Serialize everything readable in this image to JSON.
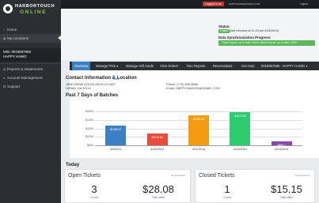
{
  "brand": {
    "name_top": "HARBORTOUCH",
    "name_bottom": "ONLINE"
  },
  "topbar": {
    "logged_in": "Logged in as",
    "user_email": "HAPPYHAWK@GMAIL.COM",
    "logout": "Logout"
  },
  "sidebar": {
    "home": "Home",
    "my_locations": "My Locations",
    "mid_line1": "MID: 0018687658",
    "mid_line2": "HAPPY HAWG",
    "reports": "Reports & Statements",
    "account": "Account Management",
    "support": "Support"
  },
  "status": {
    "label": "Status:",
    "online": "Online",
    "checked_in": "(last checked at 11:23 am 4/16/2014)",
    "sync_label": "Data Synchronization Progress:",
    "sync_text": "Ticket Import: up to date; 100%; Batch Import: up to date; 100%"
  },
  "tabs": [
    "Overview",
    "Manage POS ▾",
    "Manage Gift Cards",
    "View Orders",
    "Run Reports",
    "Reservations",
    "Get Help",
    "0018687658 - HAPPY HAWG ▾"
  ],
  "contact": {
    "title": "Contact Information & Location",
    "edit": "Edit",
    "address1": "1858 HIRAM DOUGLASVILLE HWY",
    "address2": "HIRAM, GA 30141",
    "phone": "Phone: (770) 635-8686",
    "email": "Email: HAPPYHAWG93@GMAIL.COM"
  },
  "batches_title": "Past 7 Days of Batches",
  "chart_data": {
    "type": "bar",
    "categories": [
      "4/9/2014",
      "4/10/2014",
      "4/11/2014",
      "4/13/2014",
      "4/14/2014"
    ],
    "values": [
      1268.92,
      1070.82,
      1505.48,
      1572.98,
      886.7
    ],
    "labels": [
      "$1268.92",
      "$1070.82",
      "$1505.48",
      "$1572.98",
      "$886.7"
    ],
    "colors": [
      "#3b80c4",
      "#e74c3c",
      "#f39c12",
      "#2ecc71",
      "#8e44ad"
    ],
    "yticks": [
      "$1600",
      "$1400",
      "$1200",
      "$1000",
      "$800"
    ],
    "ylim": [
      800,
      1600
    ],
    "grid": true
  },
  "today": {
    "title": "Today",
    "open": {
      "title": "Open Tickets",
      "asof": "as of 11:23 am",
      "count": "3",
      "count_label": "Count",
      "total": "$28.08",
      "total_label": "Total value"
    },
    "closed": {
      "title": "Closed Tickets",
      "asof": "as of 11:23 am",
      "count": "1",
      "count_label": "Count",
      "total": "$15.15",
      "total_label": "Total value"
    }
  }
}
